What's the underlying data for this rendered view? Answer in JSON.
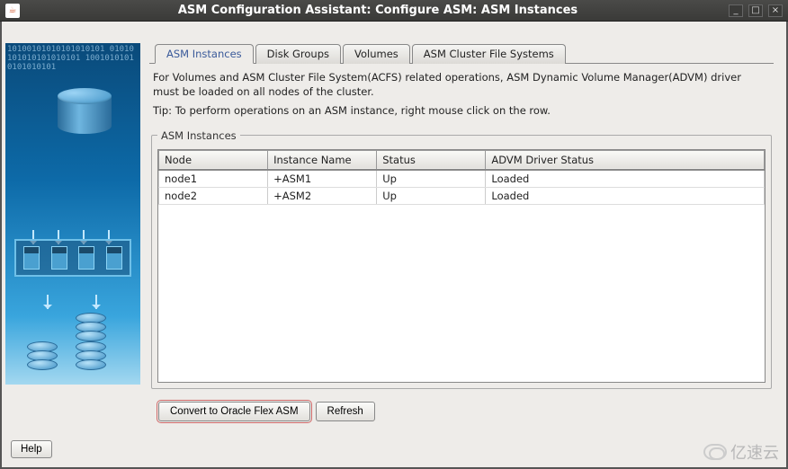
{
  "window": {
    "title": "ASM Configuration Assistant: Configure ASM: ASM Instances",
    "java_icon_label": "☕"
  },
  "tabs": [
    {
      "label": "ASM Instances",
      "active": true
    },
    {
      "label": "Disk Groups",
      "active": false
    },
    {
      "label": "Volumes",
      "active": false
    },
    {
      "label": "ASM Cluster File Systems",
      "active": false
    }
  ],
  "instructions": {
    "line1": "For Volumes and ASM Cluster File System(ACFS) related operations, ASM Dynamic Volume Manager(ADVM) driver must be loaded on all nodes of the cluster.",
    "line2": "Tip: To perform operations on an ASM instance, right mouse click on the row."
  },
  "fieldset_legend": "ASM Instances",
  "table": {
    "headers": [
      "Node",
      "Instance Name",
      "Status",
      "ADVM Driver Status"
    ],
    "rows": [
      {
        "node": "node1",
        "instance": "+ASM1",
        "status": "Up",
        "advm": "Loaded"
      },
      {
        "node": "node2",
        "instance": "+ASM2",
        "status": "Up",
        "advm": "Loaded"
      }
    ]
  },
  "buttons": {
    "convert": "Convert to Oracle Flex ASM",
    "refresh": "Refresh",
    "help": "Help"
  },
  "watermark_text": "亿速云",
  "sidebar_binary": "10100101010101010101 01010101010101010101 10010101010101010101"
}
